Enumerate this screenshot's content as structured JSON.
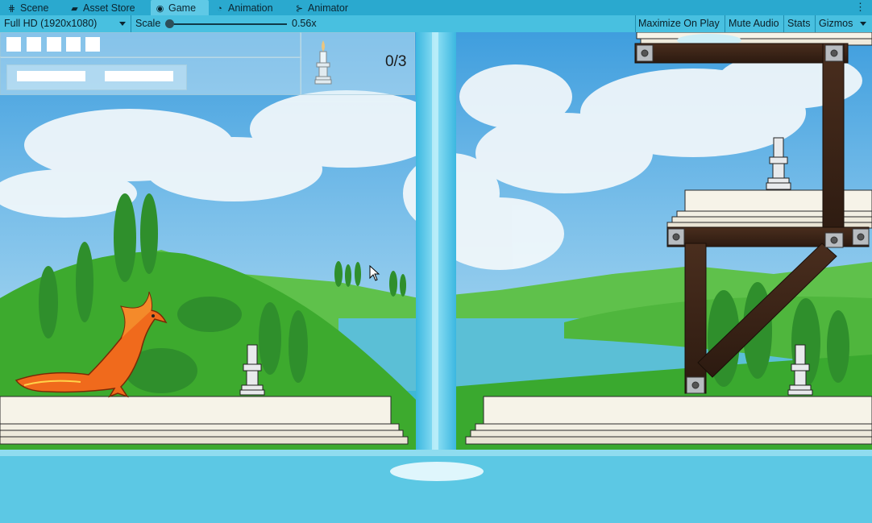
{
  "tabs": [
    {
      "label": "Scene",
      "icon": "grid-icon",
      "active": false
    },
    {
      "label": "Asset Store",
      "icon": "bag-icon",
      "active": false
    },
    {
      "label": "Game",
      "icon": "gamepad-icon",
      "active": true
    },
    {
      "label": "Animation",
      "icon": "clock-icon",
      "active": false
    },
    {
      "label": "Animator",
      "icon": "animator-icon",
      "active": false
    }
  ],
  "toolbar": {
    "resolution": "Full HD (1920x1080)",
    "scale_label": "Scale",
    "scale_value": "0.56x",
    "maximize_on_play": "Maximize On Play",
    "mute_audio": "Mute Audio",
    "stats": "Stats",
    "gizmos": "Gizmos"
  },
  "hud": {
    "candle_counter": "0/3",
    "candles_collected": 0,
    "candles_total": 3
  },
  "colors": {
    "sky": "#4fa7e0",
    "water": "#5cc8e4",
    "grass": "#3bb23a",
    "wood": "#3a2418",
    "platform": "#f4f1e6",
    "phoenix": "#f06a1c"
  }
}
